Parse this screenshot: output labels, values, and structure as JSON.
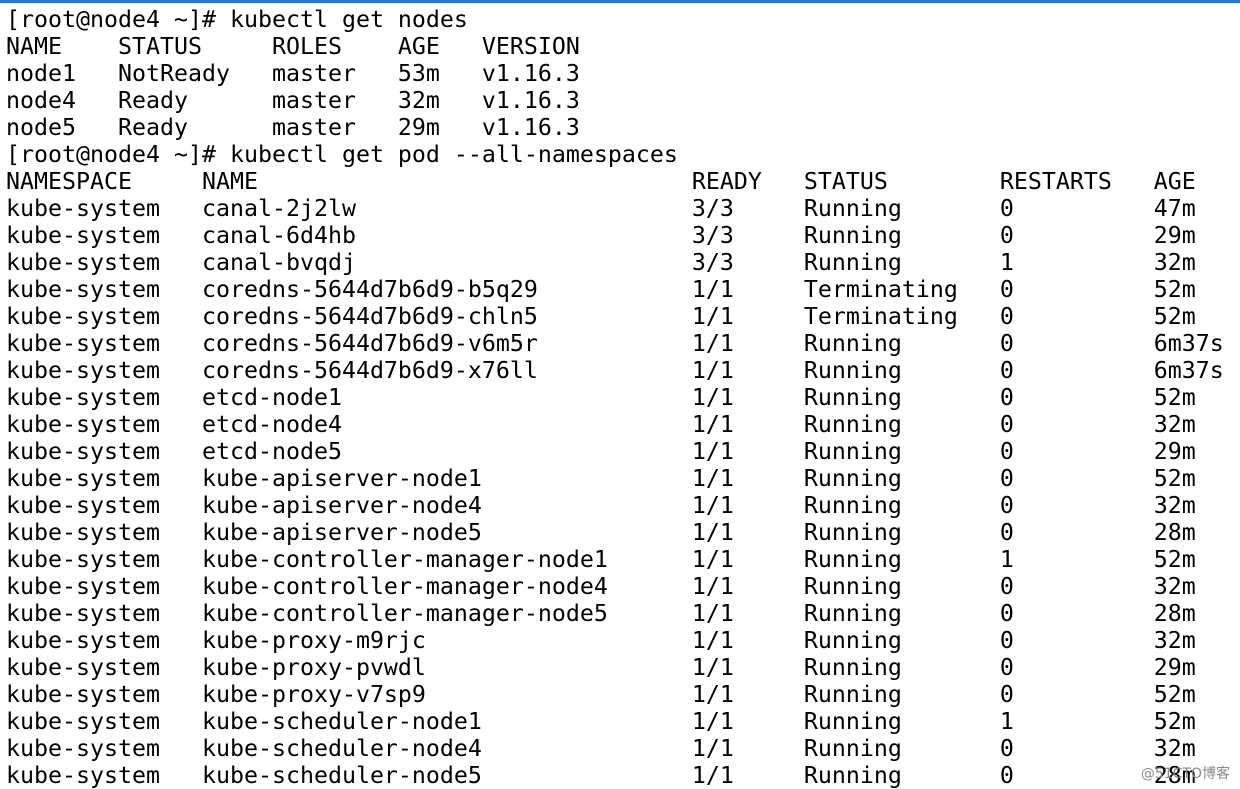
{
  "colors": {
    "background": "#ffffff",
    "text": "#000000",
    "window_top_border": "#1e78d6",
    "watermark": "#8a8a8a"
  },
  "terminal": {
    "lines": [
      "[root@node4 ~]# kubectl get nodes",
      "NAME    STATUS     ROLES    AGE   VERSION",
      "node1   NotReady   master   53m   v1.16.3",
      "node4   Ready      master   32m   v1.16.3",
      "node5   Ready      master   29m   v1.16.3",
      "[root@node4 ~]# kubectl get pod --all-namespaces",
      "NAMESPACE     NAME                               READY   STATUS        RESTARTS   AGE",
      "kube-system   canal-2j2lw                        3/3     Running       0          47m",
      "kube-system   canal-6d4hb                        3/3     Running       0          29m",
      "kube-system   canal-bvqdj                        3/3     Running       1          32m",
      "kube-system   coredns-5644d7b6d9-b5q29           1/1     Terminating   0          52m",
      "kube-system   coredns-5644d7b6d9-chln5           1/1     Terminating   0          52m",
      "kube-system   coredns-5644d7b6d9-v6m5r           1/1     Running       0          6m37s",
      "kube-system   coredns-5644d7b6d9-x76ll           1/1     Running       0          6m37s",
      "kube-system   etcd-node1                         1/1     Running       0          52m",
      "kube-system   etcd-node4                         1/1     Running       0          32m",
      "kube-system   etcd-node5                         1/1     Running       0          29m",
      "kube-system   kube-apiserver-node1               1/1     Running       0          52m",
      "kube-system   kube-apiserver-node4               1/1     Running       0          32m",
      "kube-system   kube-apiserver-node5               1/1     Running       0          28m",
      "kube-system   kube-controller-manager-node1      1/1     Running       1          52m",
      "kube-system   kube-controller-manager-node4      1/1     Running       0          32m",
      "kube-system   kube-controller-manager-node5      1/1     Running       0          28m",
      "kube-system   kube-proxy-m9rjc                   1/1     Running       0          32m",
      "kube-system   kube-proxy-pvwdl                   1/1     Running       0          29m",
      "kube-system   kube-proxy-v7sp9                   1/1     Running       0          52m",
      "kube-system   kube-scheduler-node1               1/1     Running       1          52m",
      "kube-system   kube-scheduler-node4               1/1     Running       0          32m",
      "kube-system   kube-scheduler-node5               1/1     Running       0          28m"
    ]
  },
  "watermark": {
    "text": "@51CTO博客"
  }
}
